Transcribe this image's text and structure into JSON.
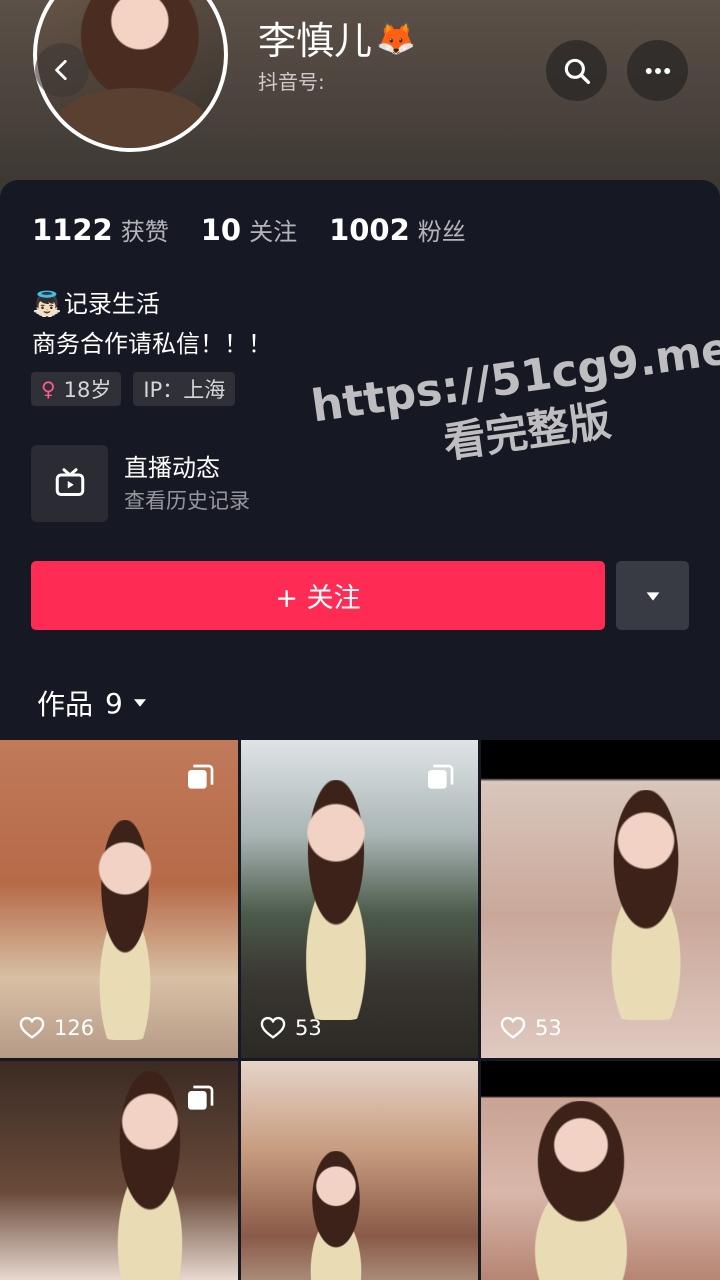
{
  "profile": {
    "name": "李慎儿",
    "name_emoji": "🦊",
    "douyin_id_label": "抖音号:",
    "stats": [
      {
        "value": "1122",
        "label": "获赞"
      },
      {
        "value": "10",
        "label": "关注"
      },
      {
        "value": "1002",
        "label": "粉丝"
      }
    ],
    "bio_emoji": "👼🏻",
    "bio_line1": "记录生活",
    "bio_line2": "商务合作请私信！！！",
    "tags": {
      "age": "18岁",
      "ip": "IP：上海"
    },
    "live": {
      "title": "直播动态",
      "subtitle": "查看历史记录"
    }
  },
  "actions": {
    "follow_label": "+ 关注"
  },
  "works_tab": {
    "label": "作品",
    "count": "9"
  },
  "watermark": {
    "line1": "https://51cg9.me",
    "line2": "看完整版"
  },
  "grid": {
    "tiles": [
      {
        "likes": "126",
        "multi": true
      },
      {
        "likes": "53",
        "multi": true
      },
      {
        "likes": "53",
        "multi": false
      },
      {
        "likes": "",
        "multi": true
      },
      {
        "likes": "",
        "multi": false
      },
      {
        "likes": "",
        "multi": false
      }
    ]
  },
  "colors": {
    "accent": "#fe2c55",
    "background": "#161823",
    "female_icon": "#ff5a8a"
  },
  "icons": [
    "back-icon",
    "search-icon",
    "more-icon",
    "female-icon",
    "tv-icon",
    "caret-down-icon",
    "heart-icon",
    "multi-image-icon"
  ]
}
